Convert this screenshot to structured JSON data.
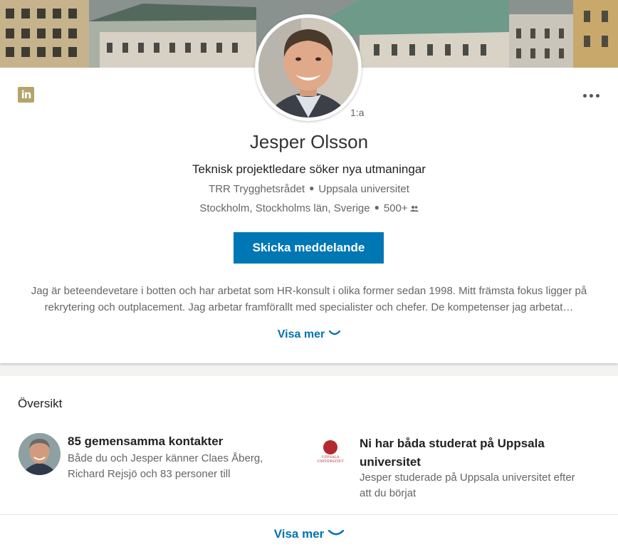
{
  "profile": {
    "name": "Jesper Olsson",
    "degree": "1:a",
    "headline": "Teknisk projektledare söker nya utmaningar",
    "company": "TRR Trygghetsrådet",
    "education": "Uppsala universitet",
    "location": "Stockholm, Stockholms län, Sverige",
    "connections": "500+",
    "message_button": "Skicka meddelande",
    "summary": "Jag är beteendevetare i botten och har arbetat som HR-konsult i olika former sedan 1998. Mitt främsta fokus ligger på rekrytering och outplacement. Jag arbetar framförallt med specialister och chefer. De kompetenser jag arbetat…",
    "show_more": "Visa mer"
  },
  "overview": {
    "title": "Översikt",
    "mutual": {
      "title": "85 gemensamma kontakter",
      "description": "Både du och Jesper känner Claes Åberg, Richard Rejsjö och 83 personer till"
    },
    "school": {
      "title": "Ni har båda studerat på Uppsala universitet",
      "description": "Jesper studerade på Uppsala universitet efter att du börjat",
      "logo_text": "UPPSALA UNIVERSITET"
    },
    "show_more": "Visa mer"
  },
  "colors": {
    "primary_button": "#0077b5",
    "link": "#0073b1",
    "linkedin_logo": "#b3a46a",
    "university_red": "#b22a2f"
  },
  "icons": {
    "logo": "linkedin-logo-icon",
    "more": "more-horizontal-icon",
    "connections": "people-icon",
    "chevron": "chevron-down-icon"
  }
}
